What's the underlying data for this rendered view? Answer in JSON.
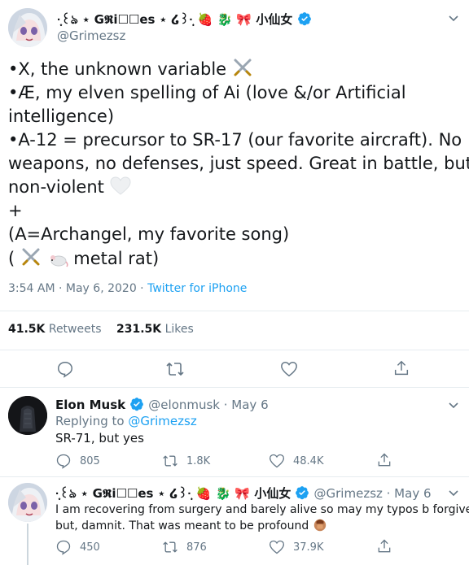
{
  "main_tweet": {
    "display_name": "·̩͙꒰ঌ ⋆ G𝕽i☐☐es ⋆ ໒꒱·̩͙ 🍓 🐉 🎀 小仙女",
    "handle": "@Grimezsz",
    "lines": [
      "•X, the unknown variable",
      "•Æ, my elven spelling of Ai (love &/or Artificial",
      "intelligence)",
      "•A-12 = precursor to SR-17 (our favorite aircraft).  No",
      "weapons, no defenses, just speed.  Great in battle, but",
      "non-violent",
      "+",
      "(A=Archangel, my favorite song)",
      "(",
      "metal rat)"
    ],
    "time": "3:54 AM · May 6, 2020 · ",
    "source": "Twitter for iPhone",
    "retweets_count": "41.5K",
    "retweets_label": "Retweets",
    "likes_count": "231.5K",
    "likes_label": "Likes"
  },
  "reply1": {
    "display_name": "Elon Musk",
    "handle": "@elonmusk · May 6",
    "replying_prefix": "Replying to ",
    "replying_to": "@Grimezsz",
    "text": "SR-71, but yes",
    "replies": "805",
    "retweets": "1.8K",
    "likes": "48.4K"
  },
  "reply2": {
    "display_name": "·̩͙꒰ঌ ⋆ G𝕽i☐☐es ⋆ ໒꒱·̩͙ 🍓 🐉 🎀 小仙女",
    "handle": "@Grimezsz · May 6",
    "line1": "I am recovering from surgery and barely alive so may my typos b forgiven",
    "line2": "but, damnit.  That was meant to be profound",
    "replies": "450",
    "retweets": "876",
    "likes": "37.9K"
  },
  "colors": {
    "link": "#1da1f2",
    "muted": "#657786",
    "text": "#14171a"
  },
  "icons": [
    "reply-icon",
    "retweet-icon",
    "like-icon",
    "share-icon",
    "verified-icon",
    "chevron-down-icon",
    "crossed-swords-emoji",
    "white-heart-emoji",
    "rat-emoji",
    "facepalm-emoji"
  ]
}
